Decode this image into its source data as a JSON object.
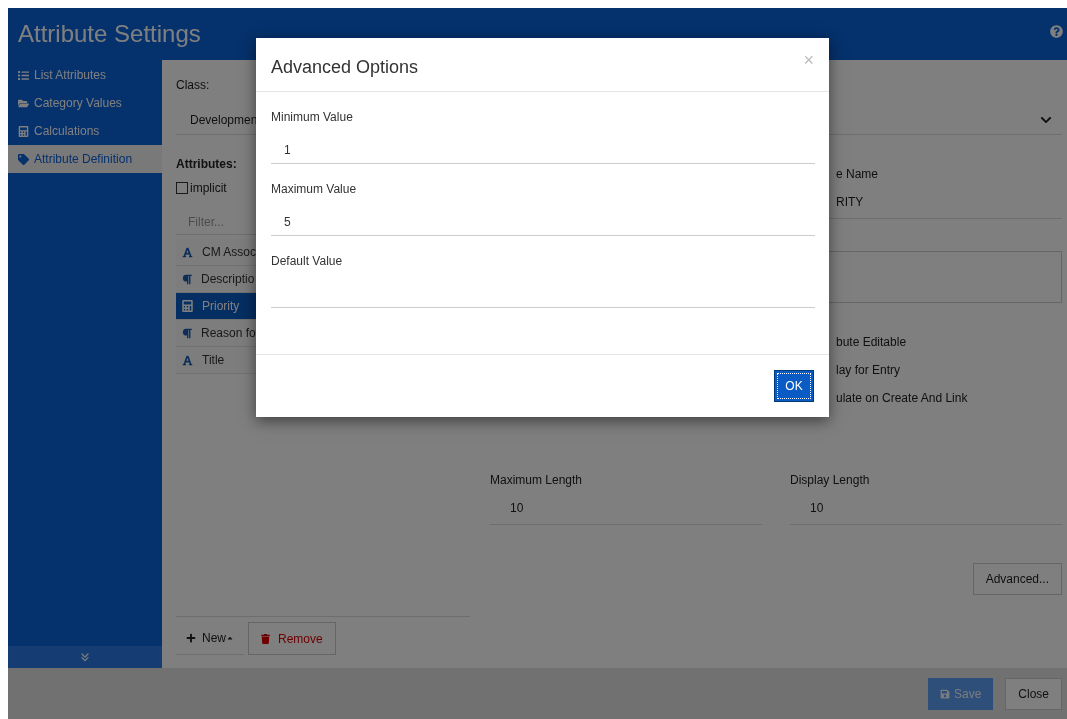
{
  "header": {
    "title": "Attribute Settings"
  },
  "sidebar": {
    "items": [
      {
        "label": "List Attributes",
        "kind": "list",
        "selected": false
      },
      {
        "label": "Category Values",
        "kind": "folder",
        "selected": false
      },
      {
        "label": "Calculations",
        "kind": "calculator",
        "selected": false
      },
      {
        "label": "Attribute Definition",
        "kind": "tag",
        "selected": true
      }
    ]
  },
  "class_field": {
    "label": "Class:",
    "value": "Developmen"
  },
  "attributes": {
    "label": "Attributes:",
    "implicit": {
      "label": "implicit",
      "checked": false
    },
    "filter": {
      "placeholder": "Filter..."
    },
    "items": [
      {
        "label": "CM Assoc",
        "kind": "text",
        "selected": false
      },
      {
        "label": "Descriptio",
        "kind": "paragraph",
        "selected": false
      },
      {
        "label": "Priority",
        "kind": "calculated",
        "selected": true
      },
      {
        "label": "Reason fo",
        "kind": "paragraph",
        "selected": false
      },
      {
        "label": "Title",
        "kind": "text",
        "selected": false
      }
    ]
  },
  "list_buttons": [
    {
      "label": "New",
      "kind": "new"
    },
    {
      "label": "Remove",
      "kind": "remove"
    }
  ],
  "details": {
    "name_label": "e Name",
    "name_value": "RITY",
    "options": [
      {
        "label": "bute Editable"
      },
      {
        "label": "lay for Entry"
      },
      {
        "label": "ulate on Create And Link"
      }
    ],
    "lengths": [
      {
        "label": "Maximum Length",
        "value": "10"
      },
      {
        "label": "Display Length",
        "value": "10"
      }
    ],
    "advanced_button": "Advanced..."
  },
  "footer": {
    "buttons": [
      {
        "label": "Save",
        "kind": "save",
        "disabled": true
      },
      {
        "label": "Close",
        "kind": "plain",
        "disabled": false
      }
    ]
  },
  "dialog": {
    "title": "Advanced Options",
    "close": "×",
    "fields": [
      {
        "label": "Minimum Value",
        "value": "1"
      },
      {
        "label": "Maximum Value",
        "value": "5"
      },
      {
        "label": "Default Value"
      }
    ],
    "ok": "OK"
  }
}
